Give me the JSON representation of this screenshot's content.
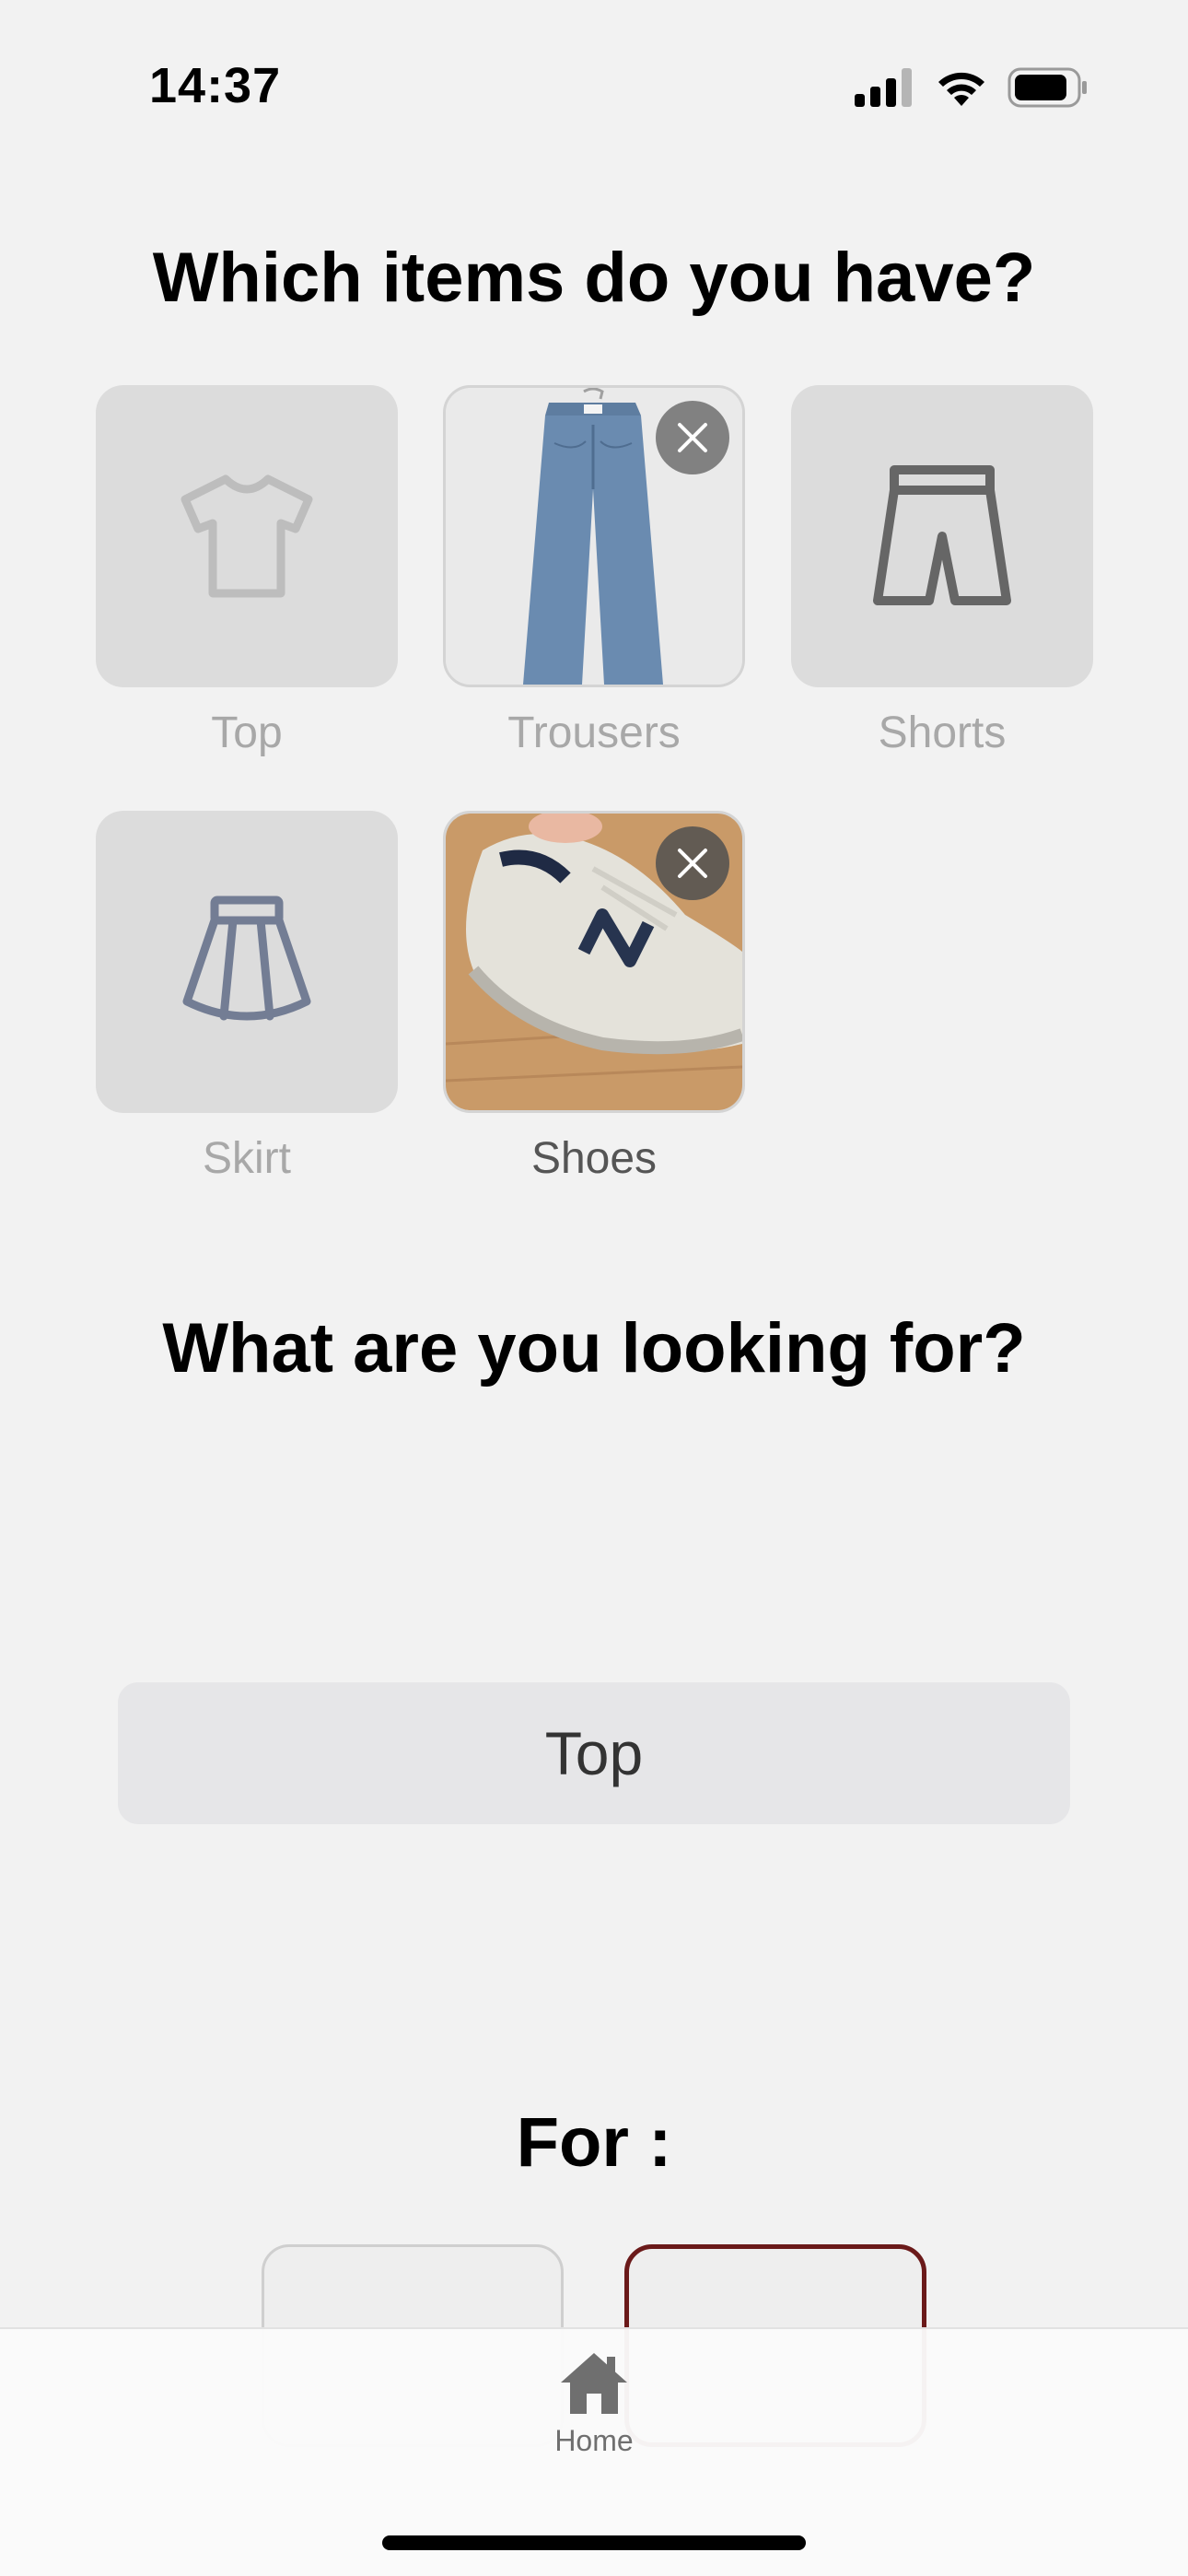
{
  "status": {
    "time": "14:37"
  },
  "section1": {
    "title": "Which items do you have?"
  },
  "items": [
    {
      "label": "Top",
      "icon": "tshirt-icon",
      "selected": false
    },
    {
      "label": "Trousers",
      "icon": "trousers-photo",
      "selected": true
    },
    {
      "label": "Shorts",
      "icon": "shorts-icon",
      "selected": false
    },
    {
      "label": "Skirt",
      "icon": "skirt-icon",
      "selected": false
    },
    {
      "label": "Shoes",
      "icon": "sneaker-photo",
      "selected": true
    }
  ],
  "section2": {
    "title": "What are you looking for?",
    "selected_value": "Top"
  },
  "section3": {
    "title": "For :"
  },
  "tabbar": {
    "home_label": "Home"
  },
  "colors": {
    "background": "#f2f2f2",
    "accent_selected_border": "#6b1a1a",
    "tile_bg": "#dcdcdc"
  }
}
